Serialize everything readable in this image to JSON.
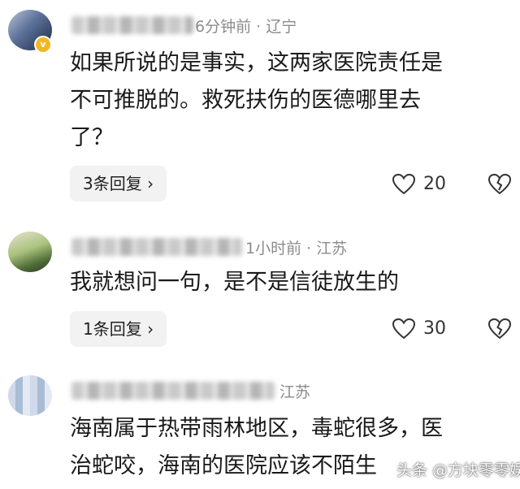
{
  "comments": [
    {
      "meta": "6分钟前 · 辽宁",
      "lines": [
        "如果所说的是事实，这两家医院责任是",
        "不可推脱的。救死扶伤的医德哪里去",
        "了？"
      ],
      "replies": "3条回复 ›",
      "likes": "20"
    },
    {
      "meta": "1小时前 · 江苏",
      "lines": [
        "我就想问一句，是不是信徒放生的"
      ],
      "replies": "1条回复 ›",
      "likes": "30"
    },
    {
      "meta": "江苏",
      "lines": [
        "海南属于热带雨林地区，毒蛇很多，医",
        "治蛇咬，海南的医院应该不陌生"
      ]
    }
  ],
  "watermark": "头条 @方块零零娱",
  "icons": [
    "heart-icon",
    "broken-heart-icon",
    "verified-badge-icon"
  ],
  "colors": {
    "badge": "#f1b825",
    "meta_text": "#8c8c8c",
    "reply_bg": "#f2f2f2"
  }
}
